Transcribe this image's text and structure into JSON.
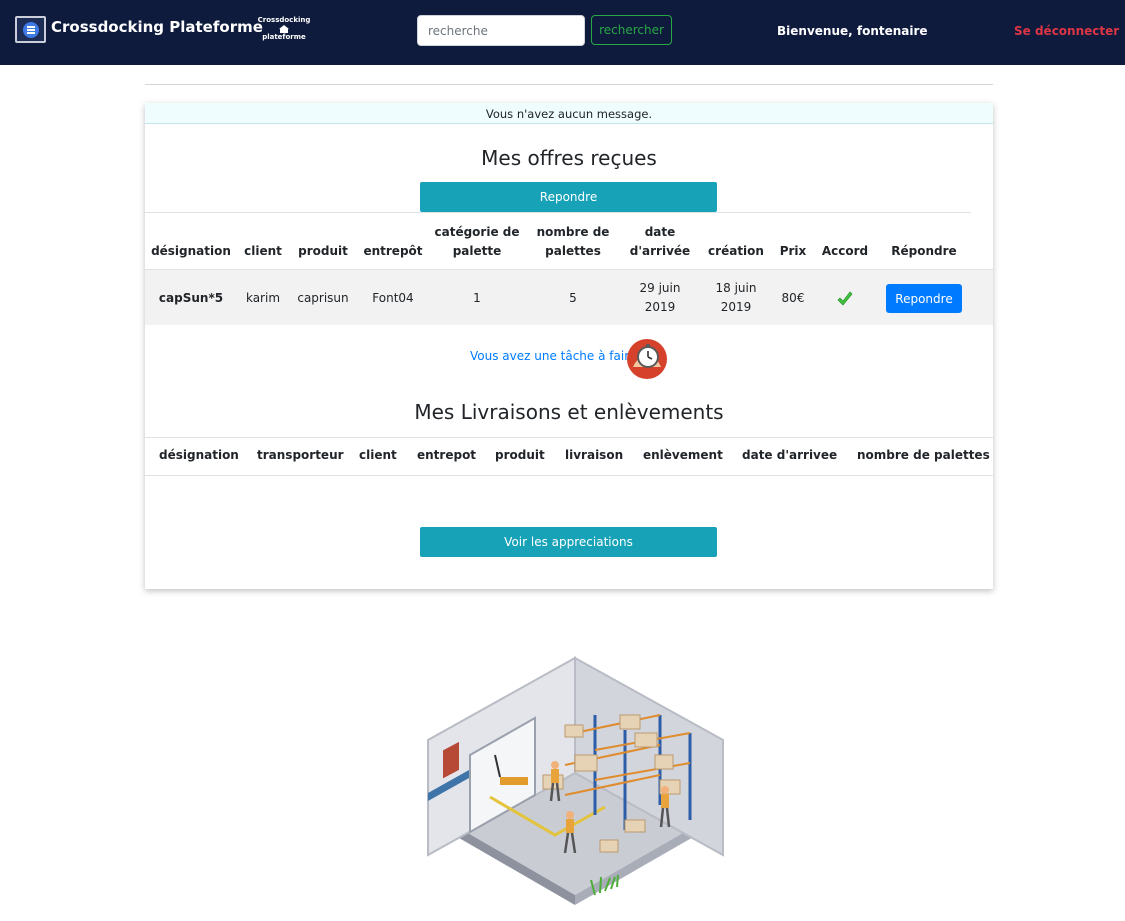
{
  "navbar": {
    "brand": "Crossdocking Plateforme",
    "logo_line1": "Crossdocking",
    "logo_line2": "plateforme",
    "search_placeholder": "recherche",
    "search_button": "rechercher",
    "welcome": "Bienvenue, fontenaire",
    "logout": "Se déconnecter",
    "icons": {
      "menu": "menu-icon",
      "logo": "house-icon"
    }
  },
  "message_bar": "Vous n'avez aucun message.",
  "offres": {
    "title": "Mes offres reçues",
    "button": "Repondre",
    "columns": [
      "désignation",
      "client",
      "produit",
      "entrepôt",
      "catégorie de palette",
      "nombre de palettes",
      "date d'arrivée",
      "création",
      "Prix",
      "Accord",
      "Répondre"
    ],
    "columns_split": {
      "categorie": [
        "catégorie de",
        "palette"
      ],
      "nombre": [
        "nombre de",
        "palettes"
      ],
      "date": [
        "date",
        "d'arrivée"
      ]
    },
    "rows": [
      {
        "designation": "capSun*5",
        "client": "karim",
        "produit": "caprisun",
        "entrepot": "Font04",
        "categorie": "1",
        "nombre": "5",
        "date_arrivee": [
          "29 juin",
          "2019"
        ],
        "creation": [
          "18 juin",
          "2019"
        ],
        "prix": "80€",
        "accord": "check-icon",
        "action": "Repondre"
      }
    ]
  },
  "task": {
    "text": "Vous avez une tâche à faire",
    "icon": "clock-task-icon"
  },
  "livraisons": {
    "title": "Mes Livraisons et enlèvements",
    "columns": [
      "désignation",
      "transporteur",
      "client",
      "entrepot",
      "produit",
      "livraison",
      "enlèvement",
      "date d'arrivee",
      "nombre de palettes"
    ],
    "button": "Voir les appreciations"
  },
  "colors": {
    "navbar": "#0e1b3d",
    "teal": "#17a2b8",
    "blue": "#007bff",
    "success": "#28a745",
    "danger": "#dc3545"
  },
  "illustration": "warehouse-illustration"
}
